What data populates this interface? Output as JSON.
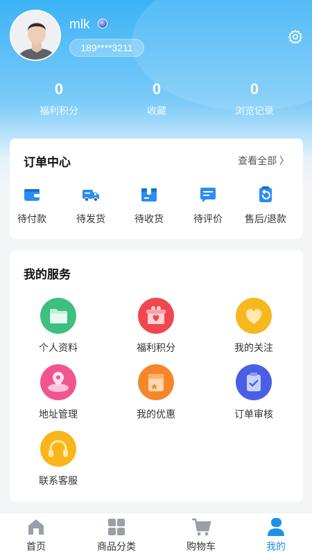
{
  "profile": {
    "username": "mlk",
    "phone": "189****3211"
  },
  "stats": [
    {
      "value": "0",
      "label": "福利积分"
    },
    {
      "value": "0",
      "label": "收藏"
    },
    {
      "value": "0",
      "label": "浏览记录"
    }
  ],
  "orders": {
    "title": "订单中心",
    "view_all": "查看全部 〉",
    "items": [
      {
        "label": "待付款",
        "icon": "wallet-icon"
      },
      {
        "label": "待发货",
        "icon": "truck-icon"
      },
      {
        "label": "待收货",
        "icon": "package-icon"
      },
      {
        "label": "待评价",
        "icon": "review-icon"
      },
      {
        "label": "售后/退款",
        "icon": "refund-icon"
      }
    ]
  },
  "services": {
    "title": "我的服务",
    "items": [
      {
        "label": "个人资料",
        "icon": "folder-icon",
        "color": "#3dbf7f"
      },
      {
        "label": "福利积分",
        "icon": "gift-icon",
        "color": "#f0464f"
      },
      {
        "label": "我的关注",
        "icon": "heart-icon",
        "color": "#f7b81f"
      },
      {
        "label": "地址管理",
        "icon": "location-map-icon",
        "color": "#f1558f"
      },
      {
        "label": "我的优惠",
        "icon": "coupon-icon",
        "color": "#f5872a"
      },
      {
        "label": "订单审核",
        "icon": "clipboard-check-icon",
        "color": "#4a5ee6"
      },
      {
        "label": "联系客服",
        "icon": "headphones-icon",
        "color": "#f8b61c"
      }
    ]
  },
  "tabbar": {
    "items": [
      {
        "label": "首页",
        "icon": "home-icon"
      },
      {
        "label": "商品分类",
        "icon": "grid-icon"
      },
      {
        "label": "购物车",
        "icon": "cart-icon"
      },
      {
        "label": "我的",
        "icon": "user-icon",
        "active": true
      }
    ]
  },
  "colors": {
    "header_gradient_top": "#3cb3f6",
    "accent": "#1e90e6",
    "icon_blue": "#2a8ef0"
  }
}
